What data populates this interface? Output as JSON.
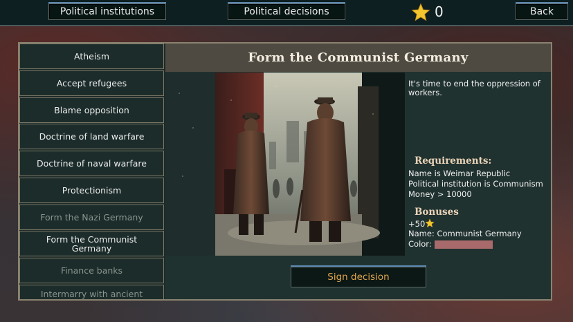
{
  "topbar": {
    "institutions_label": "Political institutions",
    "decisions_label": "Political decisions",
    "score": "0",
    "back_label": "Back"
  },
  "decisions": [
    {
      "label": "Atheism",
      "available": true
    },
    {
      "label": "Accept refugees",
      "available": true
    },
    {
      "label": "Blame opposition",
      "available": true
    },
    {
      "label": "Doctrine of land warfare",
      "available": true
    },
    {
      "label": "Doctrine of naval warfare",
      "available": true
    },
    {
      "label": "Protectionism",
      "available": true
    },
    {
      "label": "Form the Nazi Germany",
      "available": false
    },
    {
      "label": "Form the Communist Germany",
      "available": true
    },
    {
      "label": "Finance banks",
      "available": false
    },
    {
      "label": "Intermarry with ancient",
      "available": false
    }
  ],
  "detail": {
    "title": "Form the Communist Germany",
    "description": "It's time to end the oppression of workers.",
    "requirements_heading": "Requirements:",
    "requirements": [
      "Name is Weimar Republic",
      "Political institution is Communism",
      "Money > 10000"
    ],
    "bonuses_heading": "Bonuses",
    "bonus_score": "+50",
    "bonus_name": "Name: Communist Germany",
    "bonus_color_label": "Color:",
    "bonus_color": "#a86a6a",
    "sign_label": "Sign decision"
  },
  "colors": {
    "accent_blue": "#5b88b0",
    "sign_text": "#e2a74e",
    "heading_text": "#ead3b8"
  }
}
